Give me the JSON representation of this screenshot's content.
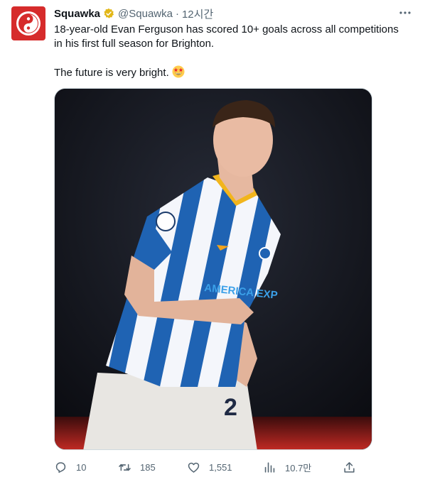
{
  "author": {
    "name": "Squawka",
    "handle": "@Squawka",
    "separator": "·",
    "time": "12시간"
  },
  "tweet": {
    "line1": "18-year-old Evan Ferguson has scored 10+ goals across all competitions in his first full season for Brighton.",
    "line2": "The future is very bright.",
    "emoji": "star-struck-emoji"
  },
  "media": {
    "jersey_number": "2",
    "sponsor_text": "AMERICA EXP"
  },
  "actions": {
    "replies": "10",
    "retweets": "185",
    "likes": "1,551",
    "views": "10.7만"
  },
  "colors": {
    "brand_red": "#d62b2b",
    "verified_gold": "#e2b719",
    "muted_text": "#536471",
    "jersey_blue": "#1f63b3"
  }
}
